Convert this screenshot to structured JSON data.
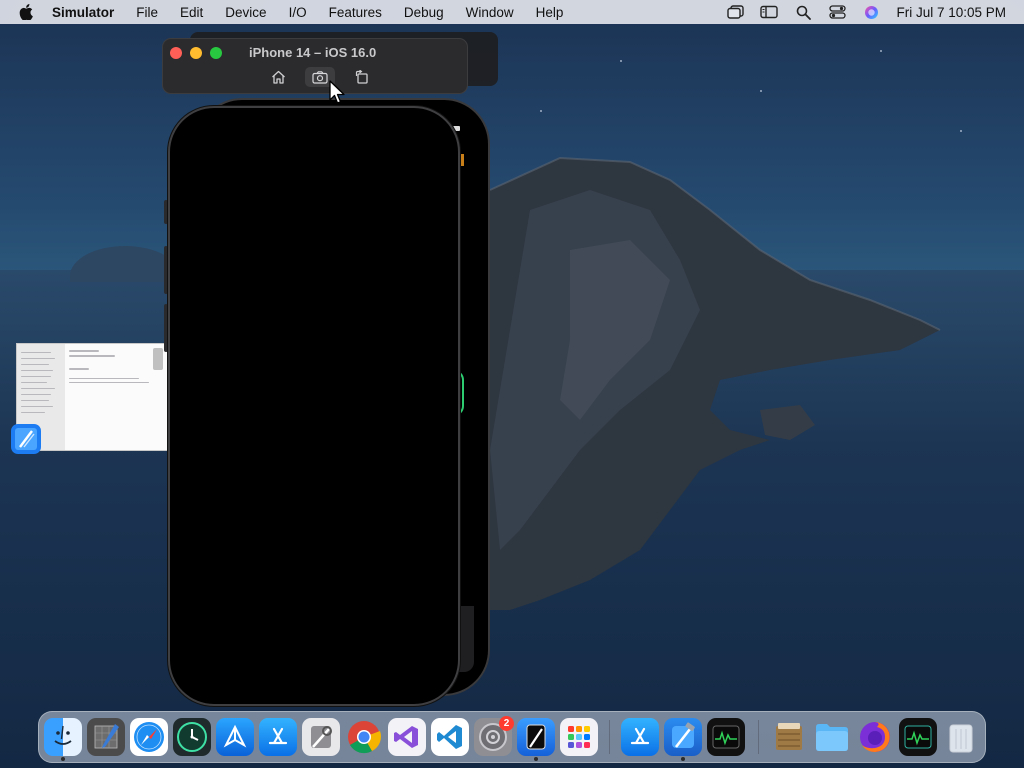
{
  "menubar": {
    "app_name": "Simulator",
    "menus": [
      "File",
      "Edit",
      "Device",
      "I/O",
      "Features",
      "Debug",
      "Window",
      "Help"
    ],
    "clock": "Fri Jul 7  10:05 PM"
  },
  "simulator": {
    "title": "iPhone 14 – iOS 16.0",
    "toolbar": {
      "home_icon": "home-icon",
      "screenshot_icon": "camera-icon",
      "rotate_icon": "rotate-icon"
    }
  },
  "dock": {
    "apps": [
      {
        "name": "finder",
        "running": true
      },
      {
        "name": "sketchbook",
        "running": false
      },
      {
        "name": "safari",
        "running": false
      },
      {
        "name": "time-machine",
        "running": false
      },
      {
        "name": "testflight",
        "running": false
      },
      {
        "name": "app-store",
        "running": false
      },
      {
        "name": "xcode-utility",
        "running": false
      },
      {
        "name": "chrome",
        "running": false
      },
      {
        "name": "visual-studio",
        "running": false
      },
      {
        "name": "vscode",
        "running": false
      },
      {
        "name": "system-preferences",
        "running": false,
        "badge": "2"
      },
      {
        "name": "simulator",
        "running": true
      },
      {
        "name": "launchpad",
        "running": false
      },
      {
        "name": "app-store-2",
        "running": false
      },
      {
        "name": "xcode",
        "running": true
      },
      {
        "name": "activity-monitor",
        "running": false
      },
      {
        "name": "archive-utility",
        "running": false
      },
      {
        "name": "downloads-folder",
        "running": false
      },
      {
        "name": "firefox",
        "running": false
      },
      {
        "name": "activity-monitor-2",
        "running": false
      },
      {
        "name": "trash",
        "running": false
      }
    ]
  }
}
